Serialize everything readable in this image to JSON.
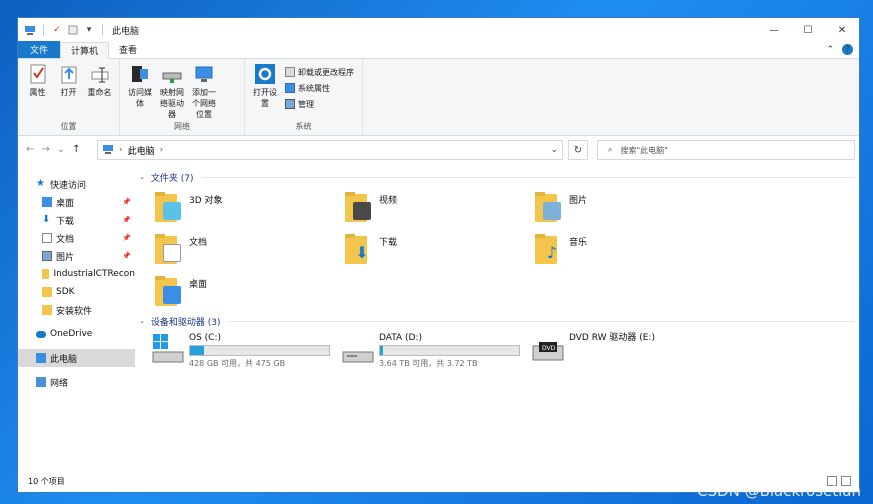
{
  "window": {
    "title": "此电脑",
    "controls": {
      "minimize": "—",
      "maximize": "☐",
      "close": "✕"
    }
  },
  "ribbon_tabs": [
    {
      "label": "文件"
    },
    {
      "label": "计算机"
    },
    {
      "label": "查看"
    }
  ],
  "ribbon": {
    "groups": {
      "location": {
        "label": "位置",
        "buttons": [
          {
            "label": "属性",
            "icon": "properties-icon"
          },
          {
            "label": "打开",
            "icon": "open-icon"
          },
          {
            "label": "重命名",
            "icon": "rename-icon"
          }
        ]
      },
      "network": {
        "label": "网络",
        "buttons": [
          {
            "label": "访问媒体",
            "icon": "media-icon"
          },
          {
            "label": "映射网络驱动器",
            "icon": "map-drive-icon"
          },
          {
            "label": "添加一个网络位置",
            "icon": "network-location-icon"
          }
        ]
      },
      "system": {
        "label": "系统",
        "open_settings": "打开设置",
        "small_buttons": [
          {
            "label": "卸载或更改程序"
          },
          {
            "label": "系统属性"
          },
          {
            "label": "管理"
          }
        ]
      }
    }
  },
  "address": {
    "path_root": "此电脑",
    "search_placeholder": "搜索\"此电脑\""
  },
  "sidebar": {
    "quick_access": "快速访问",
    "items": [
      {
        "label": "桌面",
        "pinned": true
      },
      {
        "label": "下载",
        "pinned": true
      },
      {
        "label": "文档",
        "pinned": true
      },
      {
        "label": "图片",
        "pinned": true
      },
      {
        "label": "IndustrialCTRecon",
        "pinned": false
      },
      {
        "label": "SDK",
        "pinned": false
      },
      {
        "label": "安装软件",
        "pinned": false
      }
    ],
    "onedrive": "OneDrive",
    "this_pc": "此电脑",
    "network": "网络"
  },
  "sections": {
    "folders": "文件夹 (7)",
    "devices": "设备和驱动器 (3)"
  },
  "folders": [
    {
      "label": "3D 对象"
    },
    {
      "label": "视频"
    },
    {
      "label": "图片"
    },
    {
      "label": "文档"
    },
    {
      "label": "下载"
    },
    {
      "label": "音乐"
    },
    {
      "label": "桌面"
    }
  ],
  "drives": [
    {
      "label": "OS (C:)",
      "capacity": "428 GB 可用，共 475 GB",
      "used_fraction": 0.1
    },
    {
      "label": "DATA (D:)",
      "capacity": "3.64 TB 可用，共 3.72 TB",
      "used_fraction": 0.02
    },
    {
      "label": "DVD RW 驱动器 (E:)"
    }
  ],
  "status": {
    "item_count": "10 个项目"
  },
  "watermark": "CSDN @Blackrosetian"
}
